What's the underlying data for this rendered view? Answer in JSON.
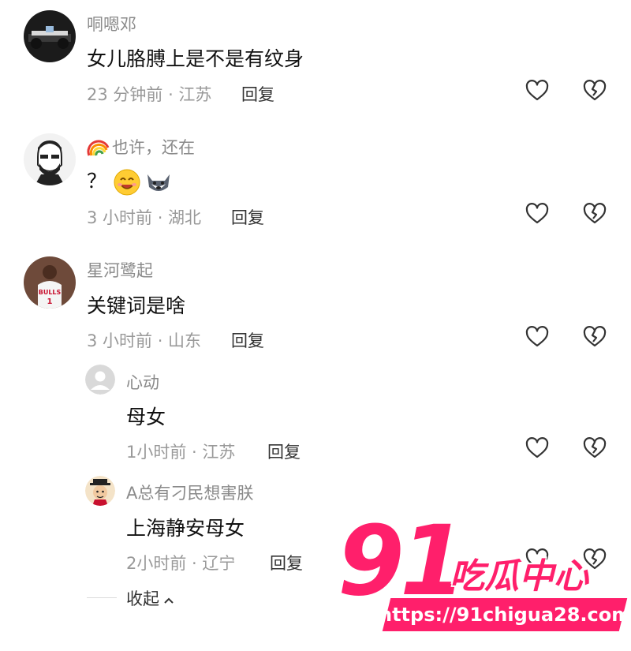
{
  "comments": [
    {
      "username": "哃嗯邓",
      "content": "女儿胳膊上是不是有纹身",
      "meta": "23 分钟前 · 江苏",
      "reply": "回复",
      "avatar_icon": "race-car-avatar"
    },
    {
      "username": "也许，还在",
      "username_prefix_icon": "rainbow-icon",
      "content": "？",
      "content_emojis": [
        "smile-emoji",
        "husky-emoji"
      ],
      "meta": "3 小时前 · 湖北",
      "reply": "回复",
      "avatar_icon": "bearded-man-avatar"
    },
    {
      "username": "星河鹭起",
      "content": "关键词是啥",
      "meta": "3 小时前 · 山东",
      "reply": "回复",
      "avatar_icon": "basketball-player-avatar"
    }
  ],
  "replies": [
    {
      "username": "心动",
      "content": "母女",
      "meta": "1小时前 · 江苏",
      "reply": "回复",
      "avatar_icon": "default-user-avatar"
    },
    {
      "username": "A总有刁民想害朕",
      "content": "上海静安母女",
      "meta": "2小时前 · 辽宁",
      "reply": "回复",
      "avatar_icon": "emperor-avatar"
    }
  ],
  "collapse_label": "收起",
  "icons": {
    "like": "heart-outline-icon",
    "dislike": "broken-heart-icon",
    "collapse": "chevron-up-icon"
  },
  "watermark": {
    "number": "91",
    "text": "吃瓜中心",
    "url": "https://91chigua28.com"
  },
  "colors": {
    "username": "#8a8a8a",
    "content": "#111111",
    "meta": "#999999",
    "watermark": "#ff1f6b"
  }
}
